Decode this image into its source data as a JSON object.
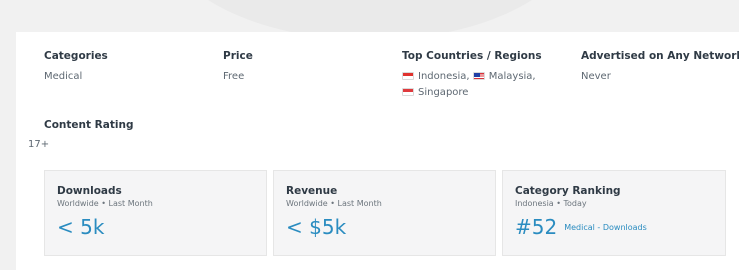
{
  "meta": {
    "categories": {
      "label": "Categories",
      "value": "Medical"
    },
    "price": {
      "label": "Price",
      "value": "Free"
    },
    "top_countries": {
      "label": "Top Countries / Regions",
      "countries": [
        {
          "name": "Indonesia,"
        },
        {
          "name": "Malaysia,"
        },
        {
          "name": "Singapore"
        }
      ]
    },
    "advertised": {
      "label": "Advertised on Any Network",
      "value": "Never"
    },
    "content_rating": {
      "label": "Content Rating",
      "value": "17+"
    }
  },
  "metrics": [
    {
      "title": "Downloads",
      "subtitle": "Worldwide • Last Month",
      "value": "< 5k"
    },
    {
      "title": "Revenue",
      "subtitle": "Worldwide • Last Month",
      "value": "< $5k"
    },
    {
      "title": "Category Ranking",
      "subtitle": "Indonesia • Today",
      "value": "#52",
      "link": "Medical - Downloads"
    }
  ],
  "theme": {
    "accent": "#2a8cc0",
    "heading": "#2f3a45",
    "muted": "#5e6872"
  }
}
